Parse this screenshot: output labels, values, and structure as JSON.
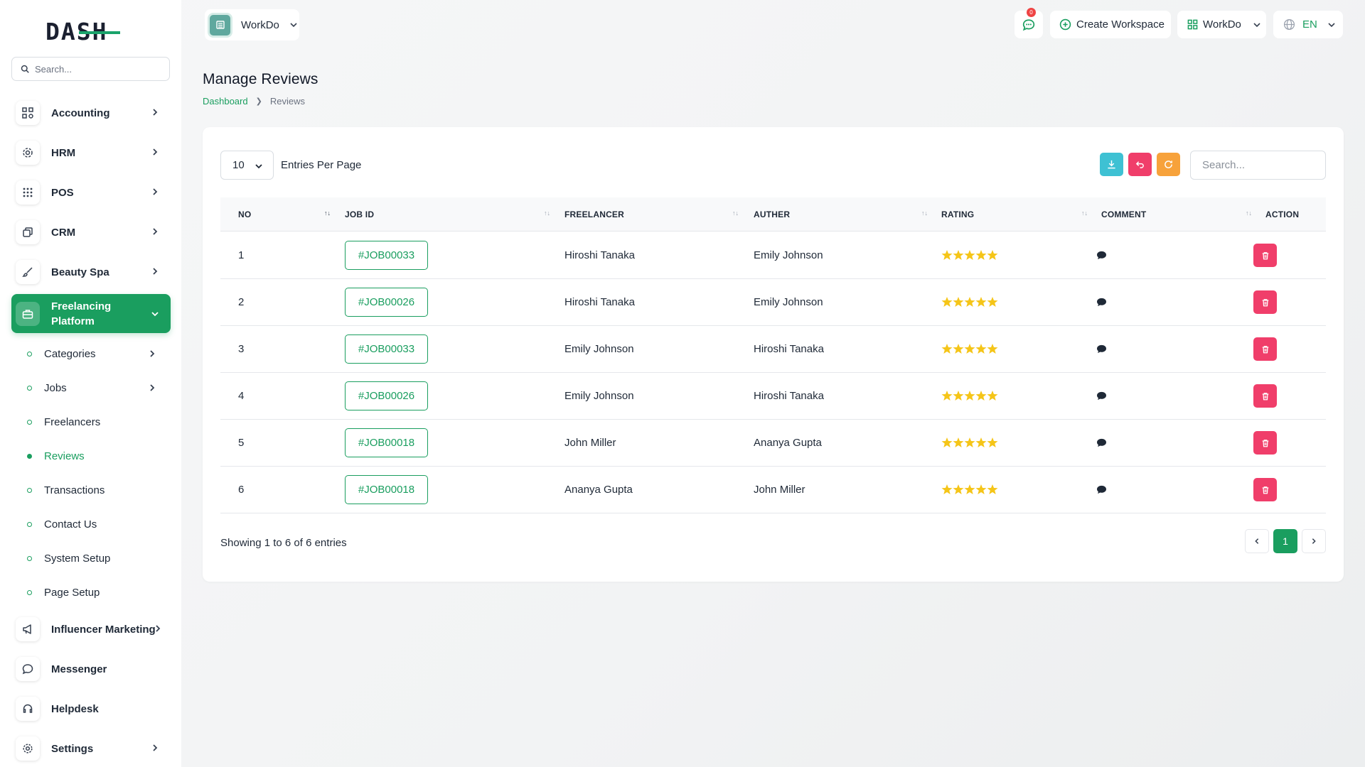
{
  "sidebar": {
    "logo": "DASH",
    "search_placeholder": "Search...",
    "items": [
      {
        "label": "Accounting",
        "icon": "accounting-icon"
      },
      {
        "label": "HRM",
        "icon": "hrm-icon"
      },
      {
        "label": "POS",
        "icon": "pos-grid-icon"
      },
      {
        "label": "CRM",
        "icon": "crm-icon"
      },
      {
        "label": "Beauty Spa",
        "icon": "brush-icon"
      },
      {
        "label": "Freelancing Platform",
        "icon": "briefcase-icon"
      },
      {
        "label": "Influencer Marketing",
        "icon": "megaphone-icon"
      },
      {
        "label": "Messenger",
        "icon": "chat-icon"
      },
      {
        "label": "Helpdesk",
        "icon": "headset-icon"
      },
      {
        "label": "Settings",
        "icon": "gear-icon"
      }
    ],
    "sub_items": [
      {
        "label": "Categories"
      },
      {
        "label": "Jobs"
      },
      {
        "label": "Freelancers"
      },
      {
        "label": "Reviews"
      },
      {
        "label": "Transactions"
      },
      {
        "label": "Contact Us"
      },
      {
        "label": "System Setup"
      },
      {
        "label": "Page Setup"
      }
    ]
  },
  "topbar": {
    "workspace": "WorkDo",
    "notification_count": "0",
    "create_workspace": "Create Workspace",
    "workspace_menu": "WorkDo",
    "language": "EN"
  },
  "page": {
    "title": "Manage Reviews",
    "breadcrumb": [
      "Dashboard",
      "Reviews"
    ]
  },
  "table": {
    "per_page": "10",
    "per_page_label": "Entries Per Page",
    "search_placeholder": "Search...",
    "columns": [
      "NO",
      "JOB ID",
      "FREELANCER",
      "AUTHER",
      "RATING",
      "COMMENT",
      "ACTION"
    ],
    "rows": [
      {
        "no": "1",
        "job_id": "#JOB00033",
        "freelancer": "Hiroshi Tanaka",
        "author": "Emily Johnson",
        "rating": 5
      },
      {
        "no": "2",
        "job_id": "#JOB00026",
        "freelancer": "Hiroshi Tanaka",
        "author": "Emily Johnson",
        "rating": 5
      },
      {
        "no": "3",
        "job_id": "#JOB00033",
        "freelancer": "Emily Johnson",
        "author": "Hiroshi Tanaka",
        "rating": 5
      },
      {
        "no": "4",
        "job_id": "#JOB00026",
        "freelancer": "Emily Johnson",
        "author": "Hiroshi Tanaka",
        "rating": 5
      },
      {
        "no": "5",
        "job_id": "#JOB00018",
        "freelancer": "John Miller",
        "author": "Ananya Gupta",
        "rating": 5
      },
      {
        "no": "6",
        "job_id": "#JOB00018",
        "freelancer": "Ananya Gupta",
        "author": "John Miller",
        "rating": 5
      }
    ],
    "showing": "Showing 1 to 6 of 6 entries",
    "current_page": "1"
  },
  "colors": {
    "accent": "#1a9e5f",
    "download": "#3ec1d3",
    "reset": "#f03e6a",
    "refresh": "#f7a23b",
    "star": "#f5c518",
    "delete": "#f03e6a"
  }
}
